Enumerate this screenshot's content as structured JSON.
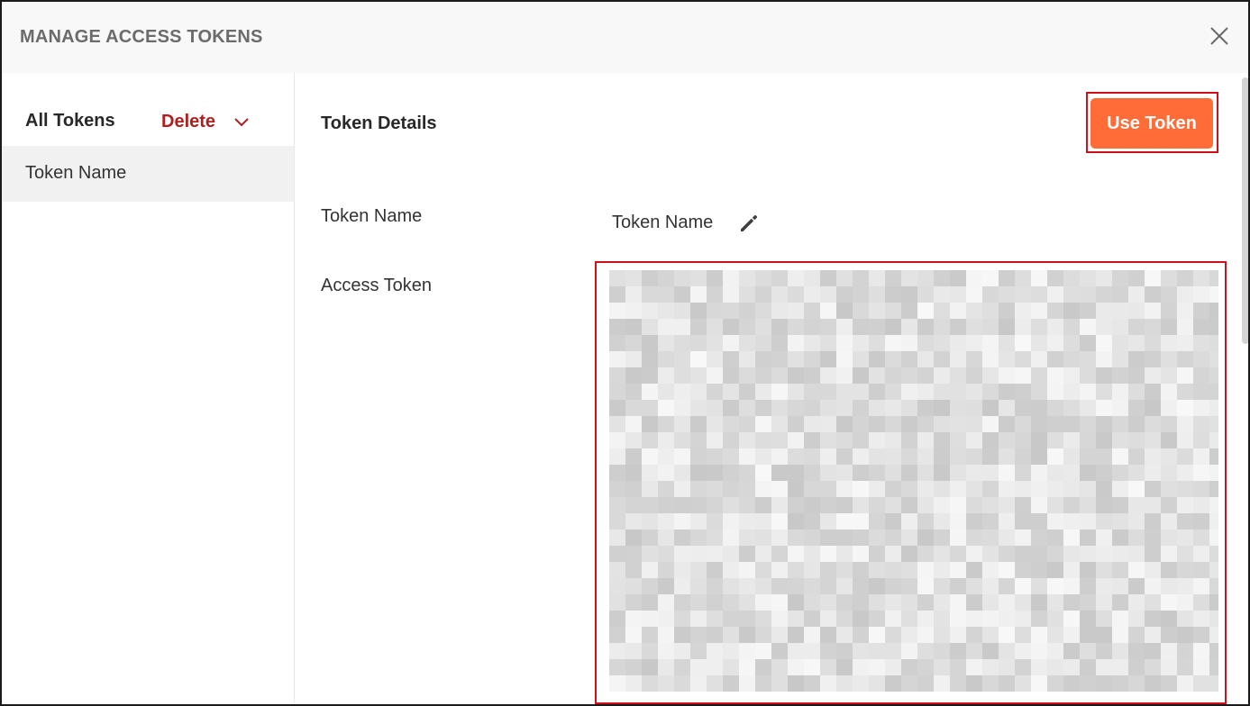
{
  "modal": {
    "title": "MANAGE ACCESS TOKENS",
    "close_icon": "close-icon"
  },
  "sidebar": {
    "title": "All Tokens",
    "delete_label": "Delete",
    "delete_icon": "chevron-down-icon",
    "items": [
      {
        "label": "Token Name",
        "selected": true
      }
    ]
  },
  "details": {
    "title": "Token Details",
    "use_token_label": "Use Token",
    "fields": {
      "name_label": "Token Name",
      "name_value": "Token Name",
      "edit_icon": "pencil-icon",
      "access_token_label": "Access Token"
    }
  },
  "colors": {
    "brand_orange": "#ff6c37",
    "delete_red": "#b01e1e",
    "highlight_red": "#d0101a",
    "header_bg": "#f8f8f8",
    "selected_item_bg": "#f1f1f1"
  }
}
